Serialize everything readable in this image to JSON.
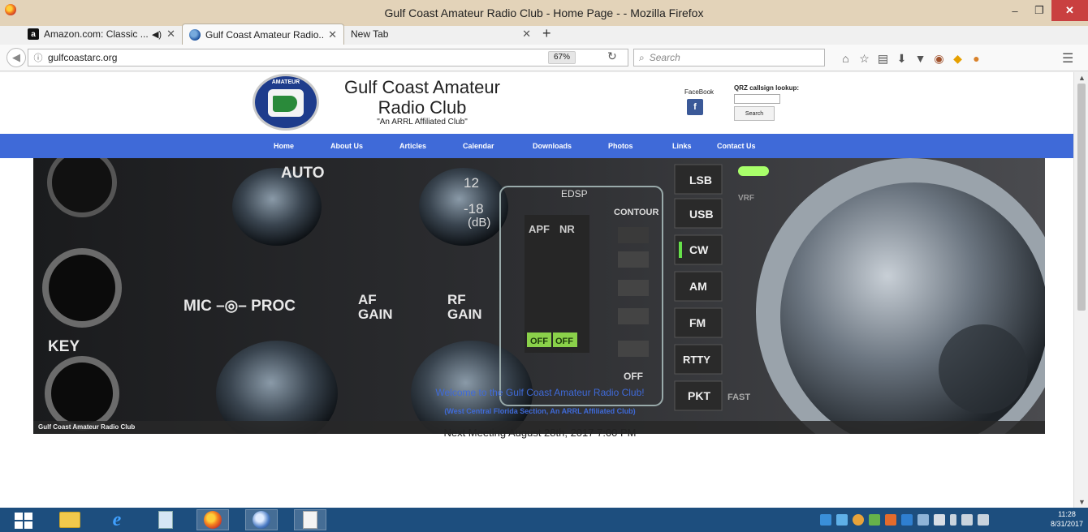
{
  "window": {
    "title": "Gulf Coast Amateur Radio Club - Home Page - - Mozilla Firefox",
    "minimize": "–",
    "restore": "❐",
    "close": "✕"
  },
  "tabs": [
    {
      "label": "Amazon.com: Classic ...",
      "favicon": "amazon-a-icon",
      "audio": "◀)"
    },
    {
      "label": "Gulf Coast Amateur Radio...",
      "favicon": "club-globe-icon"
    },
    {
      "label": "New Tab"
    }
  ],
  "navbar": {
    "url": "gulfcoastarc.org",
    "zoom": "67%",
    "search_placeholder": "Search"
  },
  "site": {
    "logo_text": "AMATEUR",
    "title_line1": "Gulf Coast Amateur",
    "title_line2": "Radio Club",
    "tagline": "\"An ARRL Affiliated Club\"",
    "facebook_label": "FaceBook",
    "facebook_icon": "f",
    "qrz_label": "QRZ callsign lookup:",
    "qrz_button": "Search",
    "nav": [
      "Home",
      "About Us",
      "Articles",
      "Calendar",
      "Downloads",
      "Photos",
      "Links",
      "Contact Us"
    ],
    "hero_caption": "Gulf Coast Amateur Radio Club",
    "welcome": "Welcome to the Gulf Coast Amateur Radio Club!",
    "section": "(West Central Florida Section, An ARRL Affiliated Club)",
    "meeting": "Next Meeting August 28th, 2017 7:00 PM"
  },
  "radio_labels": {
    "auto": "AUTO",
    "mic_proc": "MIC –◎– PROC",
    "key": "KEY",
    "af_gain": "AF",
    "af_gain2": "GAIN",
    "rf_gain": "RF",
    "rf_gain2": "GAIN",
    "db12": "12",
    "db18": "-18",
    "db": "(dB)",
    "edsp": "EDSP",
    "contour": "CONTOUR",
    "apf": "APF",
    "nr": "NR",
    "off": "OFF",
    "modes": [
      "LSB",
      "USB",
      "CW",
      "AM",
      "FM",
      "RTTY",
      "PKT"
    ],
    "fast": "FAST",
    "vrf": "VRF"
  },
  "taskbar": {
    "time": "11:28",
    "date": "8/31/2017"
  },
  "colors": {
    "nav_blue": "#3f6ad8",
    "titlebar": "#e3d3b9",
    "taskbar": "#1d4e7e",
    "facebook": "#3b5998"
  }
}
